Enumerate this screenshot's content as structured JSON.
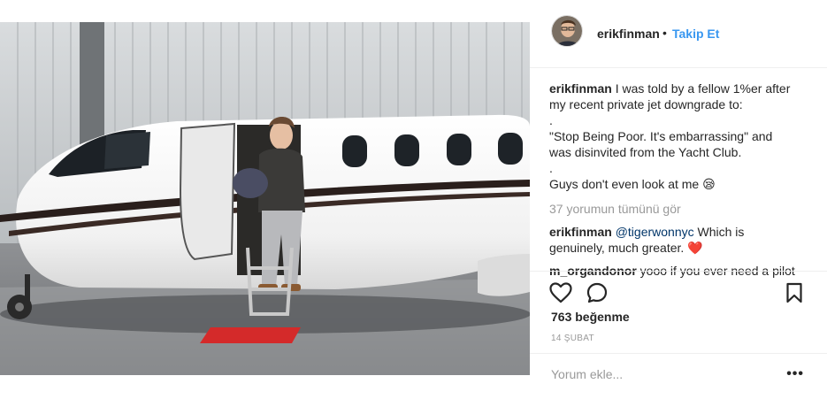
{
  "post": {
    "username": "erikfinman",
    "separator": "•",
    "follow_label": "Takip Et",
    "caption": {
      "username": "erikfinman",
      "lines": [
        "I was told by a fellow 1%er after",
        "my recent private jet downgrade to:",
        ".",
        "\"Stop Being Poor. It's embarrassing\" and",
        "was disinvited from the Yacht Club.",
        ".",
        "Guys don't even look at me 😪"
      ]
    },
    "view_all_comments": "37 yorumun tümünü gör",
    "comments": [
      {
        "username": "erikfinman",
        "mention": "@tigerwonnyc",
        "text_line1": "Which is",
        "text_line2": "genuinely, much greater. ❤️"
      },
      {
        "username": "m_organdonor",
        "text": "yooo if you ever need a pilot"
      }
    ],
    "likes": "763 beğenme",
    "date": "14 ŞUBAT",
    "comment_placeholder": "Yorum ekle...",
    "more_label": "•••"
  },
  "icons": {
    "like": "heart-icon",
    "comment": "comment-bubble-icon",
    "save": "bookmark-icon",
    "more": "more-options-icon"
  },
  "colors": {
    "link_blue": "#3897f0",
    "mention_blue": "#003569",
    "muted_gray": "#999999",
    "divider": "#efefef"
  }
}
